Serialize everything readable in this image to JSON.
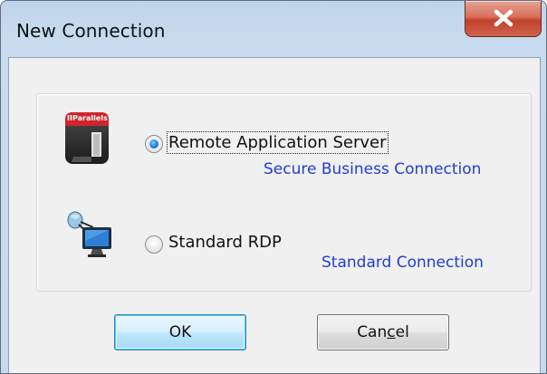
{
  "window": {
    "title": "New Connection"
  },
  "options": [
    {
      "label": "Remote Application Server",
      "description": "Secure Business Connection",
      "selected": true,
      "icon": "parallels-app-icon",
      "icon_text": "IIParallels"
    },
    {
      "label": "Standard RDP",
      "description": "Standard Connection",
      "selected": false,
      "icon": "rdp-monitor-icon"
    }
  ],
  "buttons": {
    "ok_label": "OK",
    "cancel_pre": "Can",
    "cancel_mnemonic": "c",
    "cancel_post": "el"
  },
  "colors": {
    "link": "#1f3ed0",
    "close": "#c2412a"
  }
}
